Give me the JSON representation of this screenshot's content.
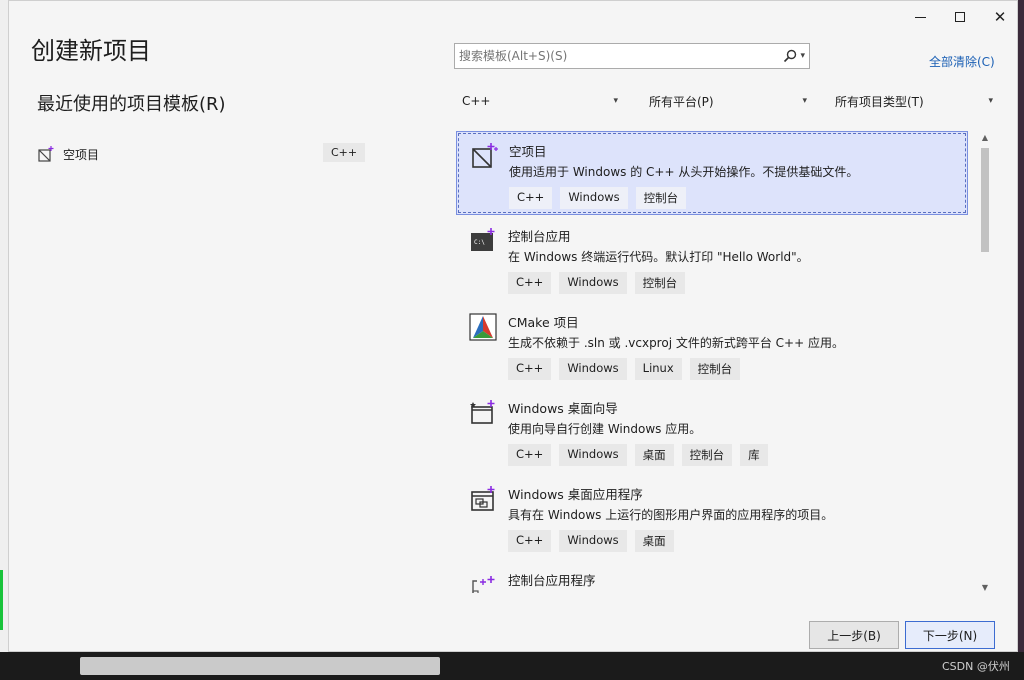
{
  "window": {
    "title": "创建新项目"
  },
  "recent": {
    "heading": "最近使用的项目模板(R)",
    "items": [
      {
        "label": "空项目",
        "tag": "C++",
        "icon": "empty-project-icon"
      }
    ]
  },
  "search": {
    "placeholder": "搜索模板(Alt+S)(S)",
    "icon": "search-icon"
  },
  "clear_all": "全部清除(C)",
  "filters": {
    "language": "C++",
    "platform": "所有平台(P)",
    "project_type": "所有项目类型(T)"
  },
  "templates": [
    {
      "name": "空项目",
      "desc": "使用适用于 Windows 的 C++ 从头开始操作。不提供基础文件。",
      "tags": [
        "C++",
        "Windows",
        "控制台"
      ],
      "icon": "empty-project-icon",
      "selected": true
    },
    {
      "name": "控制台应用",
      "desc": "在 Windows 终端运行代码。默认打印 \"Hello World\"。",
      "tags": [
        "C++",
        "Windows",
        "控制台"
      ],
      "icon": "console-app-icon"
    },
    {
      "name": "CMake 项目",
      "desc": "生成不依赖于 .sln 或 .vcxproj 文件的新式跨平台 C++ 应用。",
      "tags": [
        "C++",
        "Windows",
        "Linux",
        "控制台"
      ],
      "icon": "cmake-icon"
    },
    {
      "name": "Windows 桌面向导",
      "desc": "使用向导自行创建 Windows 应用。",
      "tags": [
        "C++",
        "Windows",
        "桌面",
        "控制台",
        "库"
      ],
      "icon": "wizard-icon"
    },
    {
      "name": "Windows 桌面应用程序",
      "desc": "具有在 Windows 上运行的图形用户界面的应用程序的项目。",
      "tags": [
        "C++",
        "Windows",
        "桌面"
      ],
      "icon": "desktop-app-icon"
    },
    {
      "name": "控制台应用程序",
      "desc": "",
      "tags": [],
      "icon": "console-wizard-icon"
    }
  ],
  "buttons": {
    "back": "上一步(B)",
    "next": "下一步(N)"
  },
  "watermark": "CSDN @伏州",
  "colors": {
    "accent": "#1a5fb4",
    "selected_bg": "#dde3fb",
    "tag_bg": "#e8e8e8",
    "cmake_red": "#d63b2f",
    "cmake_blue": "#2a6ebd",
    "cmake_green": "#3a9a3a",
    "plus_purple": "#8a2be2"
  }
}
